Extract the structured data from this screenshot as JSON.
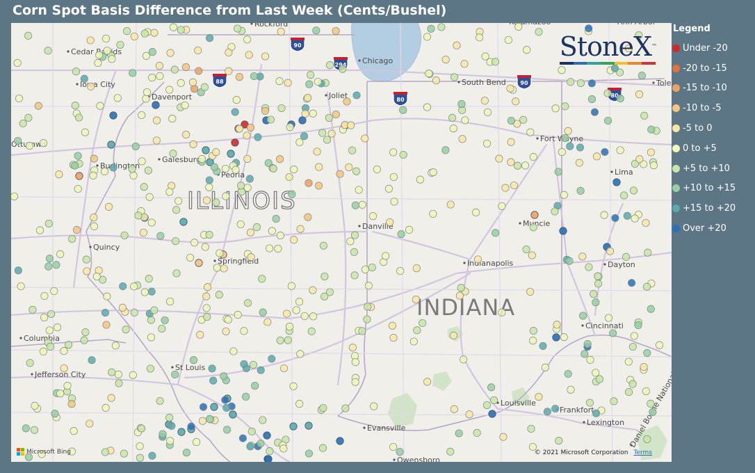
{
  "title": "Corn Spot Basis Difference from Last Week (Cents/Bushel)",
  "legend": {
    "title": "Legend",
    "items": [
      {
        "label": "Under -20",
        "color": "#d62728"
      },
      {
        "label": "-20 to -15",
        "color": "#e8703a"
      },
      {
        "label": "-15 to -10",
        "color": "#f0a060"
      },
      {
        "label": "-10 to -5",
        "color": "#f6c47e"
      },
      {
        "label": "-5 to 0",
        "color": "#fbe6a3"
      },
      {
        "label": "0 to +5",
        "color": "#f1f7b7"
      },
      {
        "label": "+5 to +10",
        "color": "#c8e6a6"
      },
      {
        "label": "+10 to +15",
        "color": "#96cfa0"
      },
      {
        "label": "+15 to +20",
        "color": "#5aa9ad"
      },
      {
        "label": "Over +20",
        "color": "#2a70b8"
      }
    ]
  },
  "logo": {
    "text": "StoneX",
    "tm": "™",
    "colors": [
      "#1d3362",
      "#2e6db4",
      "#2ea59b",
      "#3aa35a",
      "#f0c32e",
      "#e8872a",
      "#d23232"
    ]
  },
  "map": {
    "state_labels": [
      "ILLINOIS",
      "INDIANA"
    ],
    "city_labels": [
      "Rockford",
      "Kalamazoo",
      "Ann Arbor",
      "Cedar Rapids",
      "Chicago",
      "Iowa City",
      "Davenport",
      "Joliet",
      "South Bend",
      "Toledo",
      "Ottumwa",
      "Galesburg",
      "Burlington",
      "Peoria",
      "Fort Wayne",
      "Lima",
      "Danville",
      "Muncie",
      "Quincy",
      "Springfield",
      "Indianapolis",
      "Dayton",
      "Cincinnati",
      "Columbia",
      "Jefferson City",
      "St Louis",
      "Louisville",
      "Frankfort",
      "Lexington",
      "Evansville",
      "Owensboro",
      "Daniel Boone National Forest"
    ],
    "highway_shields": [
      "90",
      "294",
      "88",
      "80",
      "90",
      "80"
    ],
    "attribution": "Microsoft Bing",
    "copyright": "© 2021 Microsoft Corporation",
    "terms": "Terms"
  }
}
